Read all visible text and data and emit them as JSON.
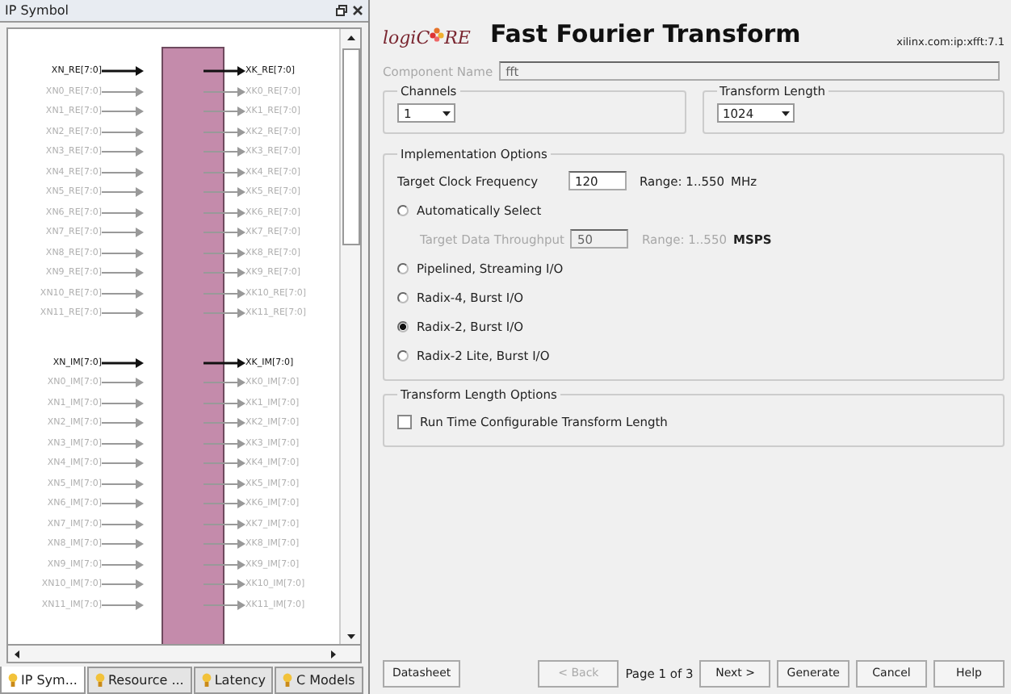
{
  "symbol_panel": {
    "title": "IP Symbol",
    "groups": [
      {
        "inputs": [
          {
            "label": "XN_RE[7:0]",
            "disabled": false
          },
          {
            "label": "XN0_RE[7:0]",
            "disabled": true
          },
          {
            "label": "XN1_RE[7:0]",
            "disabled": true
          },
          {
            "label": "XN2_RE[7:0]",
            "disabled": true
          },
          {
            "label": "XN3_RE[7:0]",
            "disabled": true
          },
          {
            "label": "XN4_RE[7:0]",
            "disabled": true
          },
          {
            "label": "XN5_RE[7:0]",
            "disabled": true
          },
          {
            "label": "XN6_RE[7:0]",
            "disabled": true
          },
          {
            "label": "XN7_RE[7:0]",
            "disabled": true
          },
          {
            "label": "XN8_RE[7:0]",
            "disabled": true
          },
          {
            "label": "XN9_RE[7:0]",
            "disabled": true
          },
          {
            "label": "XN10_RE[7:0]",
            "disabled": true
          },
          {
            "label": "XN11_RE[7:0]",
            "disabled": true
          }
        ],
        "outputs": [
          {
            "label": "XK_RE[7:0]",
            "disabled": false
          },
          {
            "label": "XK0_RE[7:0]",
            "disabled": true
          },
          {
            "label": "XK1_RE[7:0]",
            "disabled": true
          },
          {
            "label": "XK2_RE[7:0]",
            "disabled": true
          },
          {
            "label": "XK3_RE[7:0]",
            "disabled": true
          },
          {
            "label": "XK4_RE[7:0]",
            "disabled": true
          },
          {
            "label": "XK5_RE[7:0]",
            "disabled": true
          },
          {
            "label": "XK6_RE[7:0]",
            "disabled": true
          },
          {
            "label": "XK7_RE[7:0]",
            "disabled": true
          },
          {
            "label": "XK8_RE[7:0]",
            "disabled": true
          },
          {
            "label": "XK9_RE[7:0]",
            "disabled": true
          },
          {
            "label": "XK10_RE[7:0]",
            "disabled": true
          },
          {
            "label": "XK11_RE[7:0]",
            "disabled": true
          }
        ]
      },
      {
        "inputs": [
          {
            "label": "XN_IM[7:0]",
            "disabled": false
          },
          {
            "label": "XN0_IM[7:0]",
            "disabled": true
          },
          {
            "label": "XN1_IM[7:0]",
            "disabled": true
          },
          {
            "label": "XN2_IM[7:0]",
            "disabled": true
          },
          {
            "label": "XN3_IM[7:0]",
            "disabled": true
          },
          {
            "label": "XN4_IM[7:0]",
            "disabled": true
          },
          {
            "label": "XN5_IM[7:0]",
            "disabled": true
          },
          {
            "label": "XN6_IM[7:0]",
            "disabled": true
          },
          {
            "label": "XN7_IM[7:0]",
            "disabled": true
          },
          {
            "label": "XN8_IM[7:0]",
            "disabled": true
          },
          {
            "label": "XN9_IM[7:0]",
            "disabled": true
          },
          {
            "label": "XN10_IM[7:0]",
            "disabled": true
          },
          {
            "label": "XN11_IM[7:0]",
            "disabled": true
          }
        ],
        "outputs": [
          {
            "label": "XK_IM[7:0]",
            "disabled": false
          },
          {
            "label": "XK0_IM[7:0]",
            "disabled": true
          },
          {
            "label": "XK1_IM[7:0]",
            "disabled": true
          },
          {
            "label": "XK2_IM[7:0]",
            "disabled": true
          },
          {
            "label": "XK3_IM[7:0]",
            "disabled": true
          },
          {
            "label": "XK4_IM[7:0]",
            "disabled": true
          },
          {
            "label": "XK5_IM[7:0]",
            "disabled": true
          },
          {
            "label": "XK6_IM[7:0]",
            "disabled": true
          },
          {
            "label": "XK7_IM[7:0]",
            "disabled": true
          },
          {
            "label": "XK8_IM[7:0]",
            "disabled": true
          },
          {
            "label": "XK9_IM[7:0]",
            "disabled": true
          },
          {
            "label": "XK10_IM[7:0]",
            "disabled": true
          },
          {
            "label": "XK11_IM[7:0]",
            "disabled": true
          }
        ]
      }
    ],
    "tabs": [
      {
        "label": "IP Sym...",
        "selected": true
      },
      {
        "label": "Resource ...",
        "selected": false
      },
      {
        "label": "Latency",
        "selected": false
      },
      {
        "label": "C Models",
        "selected": false
      }
    ]
  },
  "header": {
    "logo": {
      "before": "logiC",
      "after": "RE"
    },
    "title": "Fast Fourier Transform",
    "vendor": "xilinx.com:ip:xfft:7.1"
  },
  "component_name": {
    "label": "Component Name",
    "value": "fft",
    "disabled": true
  },
  "channels": {
    "title": "Channels",
    "value": "1"
  },
  "transform_length": {
    "title": "Transform Length",
    "value": "1024"
  },
  "implementation": {
    "title": "Implementation Options",
    "clock": {
      "label": "Target Clock Frequency",
      "value": "120",
      "range": "Range: 1..550",
      "unit": "MHz"
    },
    "throughput": {
      "label": "Target Data Throughput",
      "value": "50",
      "range": "Range: 1..550",
      "unit": "MSPS",
      "disabled": true
    },
    "options": [
      {
        "label": "Automatically Select",
        "selected": false
      },
      {
        "label": "Pipelined, Streaming I/O",
        "selected": false
      },
      {
        "label": "Radix-4, Burst I/O",
        "selected": false
      },
      {
        "label": "Radix-2, Burst I/O",
        "selected": true
      },
      {
        "label": "Radix-2 Lite, Burst I/O",
        "selected": false
      }
    ]
  },
  "length_options": {
    "title": "Transform Length Options",
    "checkbox": {
      "label": "Run Time Configurable Transform Length",
      "checked": false
    }
  },
  "footer": {
    "datasheet": "Datasheet",
    "back": {
      "label": "< Back",
      "disabled": true
    },
    "page": "Page 1 of 3",
    "buttons": [
      "Next >",
      "Generate",
      "Cancel",
      "Help"
    ]
  }
}
